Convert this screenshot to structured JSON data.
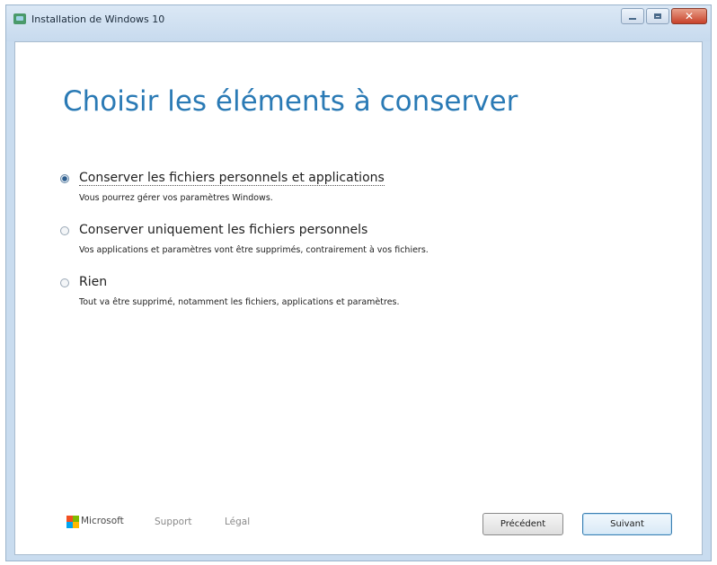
{
  "window": {
    "title": "Installation de Windows 10",
    "controls": {
      "minimize_icon": "minimize-icon",
      "maximize_icon": "maximize-icon",
      "close_icon": "close-icon",
      "close_glyph": "✕"
    }
  },
  "page": {
    "title": "Choisir les éléments à conserver"
  },
  "options": [
    {
      "label": "Conserver les fichiers personnels et applications",
      "description": "Vous pourrez gérer vos paramètres Windows.",
      "checked": true
    },
    {
      "label": "Conserver uniquement les fichiers personnels",
      "description": "Vos applications et paramètres vont être supprimés, contrairement à vos fichiers.",
      "checked": false
    },
    {
      "label": "Rien",
      "description": "Tout va être supprimé, notamment les fichiers, applications et paramètres.",
      "checked": false
    }
  ],
  "footer": {
    "brand": "Microsoft",
    "links": [
      "Support",
      "Légal"
    ],
    "logo_colors": [
      "#f25022",
      "#7fba00",
      "#00a4ef",
      "#ffb900"
    ]
  },
  "buttons": {
    "back": "Précédent",
    "next": "Suivant"
  },
  "colors": {
    "title": "#2a7ab5",
    "accent_button_border": "#3c7fb1"
  }
}
